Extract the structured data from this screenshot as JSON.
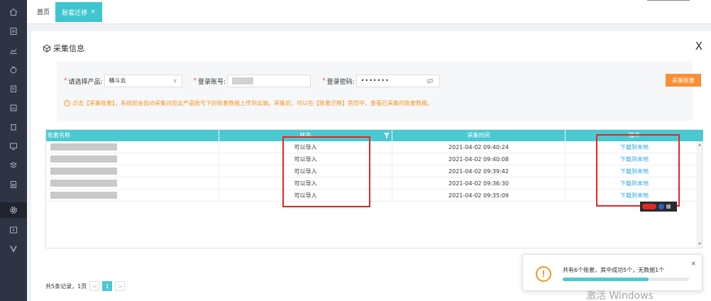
{
  "colors": {
    "sidebar": "#2f3445",
    "accent": "#3fc5d0",
    "orange": "#fb8d35",
    "link": "#29a5e6",
    "alert": "#e0271f"
  },
  "sidebar": {
    "items": [
      "home-icon",
      "document-icon",
      "chart-icon",
      "bag-icon",
      "clipboard-icon",
      "invoice-icon",
      "stamp-icon",
      "monitor-icon",
      "stack-icon",
      "receipt-icon",
      "settings-icon",
      "video-icon",
      "v-icon"
    ]
  },
  "tabs": {
    "home": "首页",
    "active": "账套迁移",
    "close": "×"
  },
  "panel": {
    "title": "采集信息",
    "close": "X",
    "form": {
      "product_label": "请选择产品:",
      "product_value": "精斗云",
      "account_label": "登录账号:",
      "password_label": "登录密码:",
      "password_value": "•••••••",
      "collect_button": "采集账套",
      "tip": "点击【采集账套】，系统就会自动采集对应云产品账号下的账套数据上传到云端。采集后，可以在【账套迁移】首页中，查看已采集的账套数据。"
    },
    "table": {
      "headers": [
        "账套名称",
        "状态",
        "采集时间",
        "操作"
      ],
      "rows": [
        {
          "status": "可以导入",
          "time": "2021-04-02 09:40:24",
          "action": "下载到本地"
        },
        {
          "status": "可以导入",
          "time": "2021-04-02 09:40:08",
          "action": "下载到本地"
        },
        {
          "status": "可以导入",
          "time": "2021-04-02 09:39:42",
          "action": "下载到本地"
        },
        {
          "status": "可以导入",
          "time": "2021-04-02 09:36:30",
          "action": "下载到本地"
        },
        {
          "status": "可以导入",
          "time": "2021-04-02 09:35:09",
          "action": "下载到本地"
        }
      ]
    },
    "pager": {
      "summary": "共5条记录，1页",
      "prev": "<",
      "current": "1",
      "next": ">"
    }
  },
  "toast": {
    "message": "共有6个账套，其中成功5个，无数据1个",
    "progress": 0.68,
    "close": "×"
  },
  "watermark": "激活 Windows"
}
